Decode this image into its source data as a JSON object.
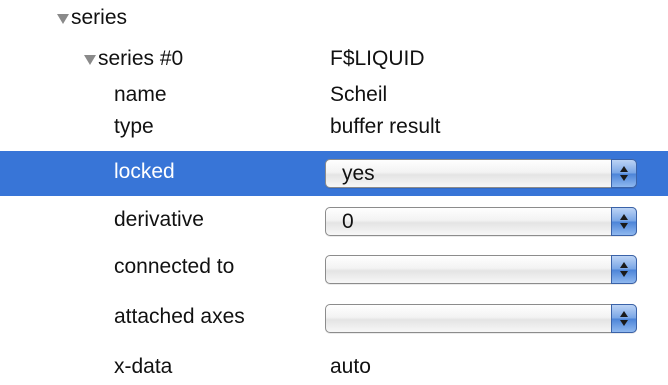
{
  "tree": {
    "root": {
      "label": "series",
      "expanded": true
    },
    "child": {
      "label": "series #0",
      "value": "F$LIQUID",
      "expanded": true
    }
  },
  "properties": {
    "name": {
      "label": "name",
      "value": "Scheil"
    },
    "type": {
      "label": "type",
      "value": "buffer result"
    },
    "locked": {
      "label": "locked",
      "value": "yes",
      "selected": true
    },
    "derivative": {
      "label": "derivative",
      "value": "0"
    },
    "connected_to": {
      "label": "connected to",
      "value": ""
    },
    "attached_axes": {
      "label": "attached axes",
      "value": ""
    },
    "x_data": {
      "label": "x-data",
      "value": "auto"
    }
  },
  "colors": {
    "selection": "#3875d7",
    "stepper": "#4c84d8",
    "disclosure": "#8a8a8a"
  },
  "icons": {
    "disclosure": "disclosure-triangle-down-icon",
    "stepper": "up-down-arrows-icon"
  }
}
